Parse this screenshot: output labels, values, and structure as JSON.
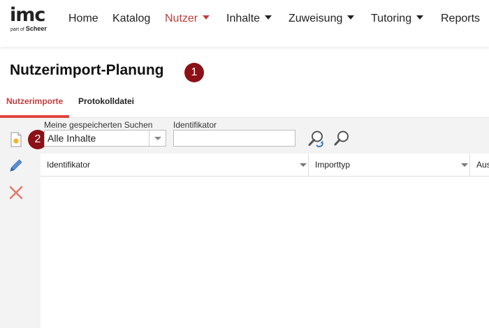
{
  "app": {
    "logo_main": "imc",
    "logo_sub_prefix": "part of",
    "logo_sub_brand": "Scheer"
  },
  "nav": {
    "items": [
      {
        "label": "Home",
        "dropdown": false
      },
      {
        "label": "Katalog",
        "dropdown": false
      },
      {
        "label": "Nutzer",
        "dropdown": true,
        "active": true
      },
      {
        "label": "Inhalte",
        "dropdown": true
      },
      {
        "label": "Zuweisung",
        "dropdown": true
      },
      {
        "label": "Tutoring",
        "dropdown": true
      },
      {
        "label": "Reports",
        "dropdown": false
      }
    ]
  },
  "page": {
    "title": "Nutzerimport-Planung",
    "badge_1": "1",
    "badge_2": "2"
  },
  "tabs": [
    {
      "label": "Nutzerimporte",
      "active": true
    },
    {
      "label": "Protokolldatei",
      "active": false
    }
  ],
  "filters": {
    "saved_search_label": "Meine gespeicherten Suchen",
    "saved_search_value": "Alle Inhalte",
    "identifier_label": "Identifikator",
    "identifier_value": ""
  },
  "toolbar": {
    "icons": [
      "new-document-icon",
      "edit-pencil-icon",
      "delete-x-icon"
    ]
  },
  "table": {
    "columns": [
      "Identifikator",
      "Importtyp",
      "Aus"
    ],
    "rows": []
  },
  "colors": {
    "accent": "#c33b3b",
    "tab_underline": "#e0443e",
    "badge": "#8b1116",
    "pencil": "#5b8fd0",
    "delete": "#e07b6a"
  }
}
